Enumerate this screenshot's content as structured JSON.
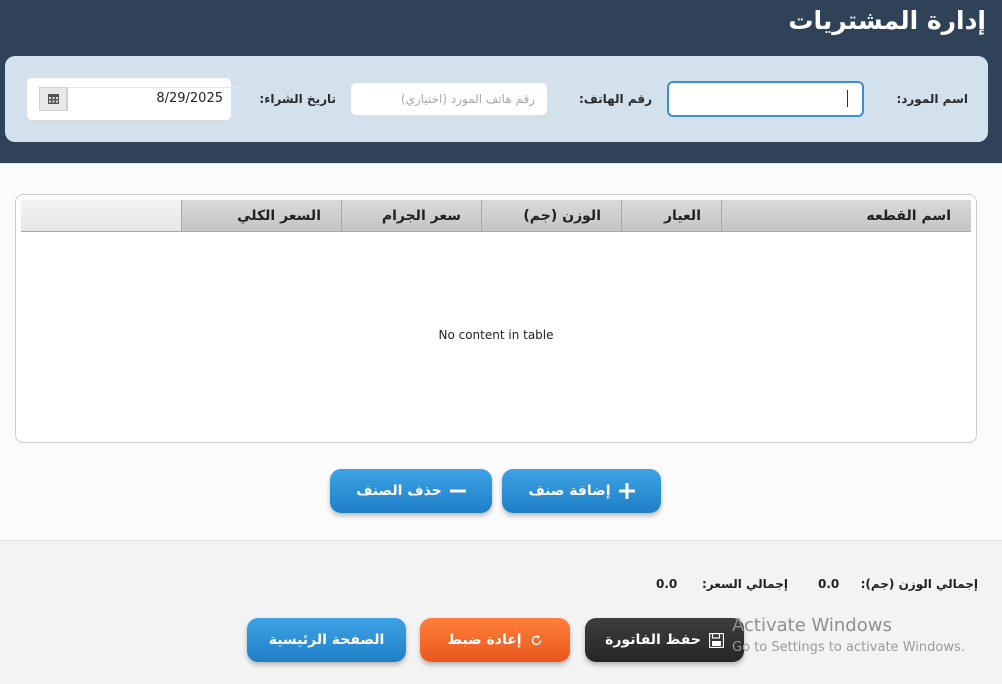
{
  "header": {
    "title": "إدارة المشتريات"
  },
  "form": {
    "supplier_label": "اسم المورد:",
    "supplier_value": "",
    "phone_label": "رقم الهاتف:",
    "phone_placeholder": "رقم هاتف المورد (اختياري)",
    "date_label": "تاريخ الشراء:",
    "date_value": "8/29/2025",
    "calendar_icon": "calendar-icon"
  },
  "table": {
    "columns": [
      "اسم القطعه",
      "العيار",
      "الوزن (جم)",
      "سعر الجرام",
      "السعر الكلي"
    ],
    "empty_message": "No content in table",
    "rows": []
  },
  "actions": {
    "add_item": "إضافة صنف",
    "delete_item": "حذف الصنف"
  },
  "totals": {
    "weight_label": "إجمالي الوزن (جم):",
    "weight_value": "0.0",
    "price_label": "إجمالي السعر:",
    "price_value": "0.0"
  },
  "footer": {
    "save_invoice": "حفظ الفاتورة",
    "reset": "إعادة ضبط",
    "home": "الصفحة الرئيسية"
  },
  "watermark": {
    "title": "Activate Windows",
    "subtitle": "Go to Settings to activate Windows."
  },
  "colors": {
    "header": "#2f4257",
    "form_panel": "#d3e1ec",
    "primary": "#2a8ed4",
    "reset": "#f26a2e",
    "save": "#333333"
  }
}
